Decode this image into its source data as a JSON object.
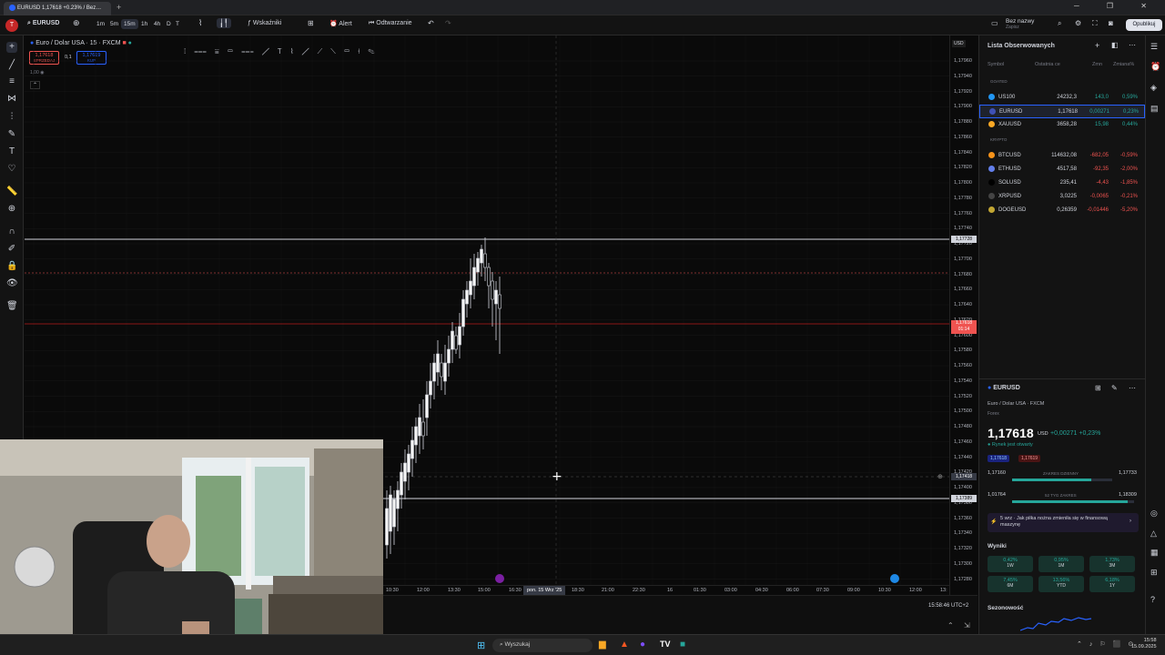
{
  "browser": {
    "tab_title": "EURUSD 1,17618 +0.23% / Bez…",
    "new_tab": "+"
  },
  "toolbar": {
    "symbol": "EURUSD",
    "timeframes": [
      "1m",
      "5m",
      "15m",
      "1h",
      "4h",
      "D",
      "T"
    ],
    "active_timeframe": "15m",
    "indicators_label": "Wskaźniki",
    "alert_label": "Alert",
    "replay_label": "Odtwarzanie",
    "layout_name": "Bez nazwy",
    "layout_sub": "Zapisz",
    "publish_label": "Opublikuj"
  },
  "chart_header": {
    "title": "Euro / Dolar USA · 15 · FXCM",
    "sell_price": "1,17618",
    "sell_label": "SPRZEDAJ",
    "spread": "0,1",
    "buy_price": "1,17619",
    "buy_label": "KUP",
    "volume": "1,00"
  },
  "price_axis": {
    "currency": "USD",
    "labels": [
      "1,17960",
      "1,17940",
      "1,17920",
      "1,17900",
      "1,17880",
      "1,17860",
      "1,17840",
      "1,17820",
      "1,17800",
      "1,17780",
      "1,17760",
      "1,17740",
      "1,17720",
      "1,17700",
      "1,17680",
      "1,17660",
      "1,17640",
      "1,17620",
      "1,17600",
      "1,17580",
      "1,17560",
      "1,17540",
      "1,17520",
      "1,17500",
      "1,17480",
      "1,17460",
      "1,17440",
      "1,17420",
      "1,17400",
      "1,17380",
      "1,17360",
      "1,17340",
      "1,17320",
      "1,17300",
      "1,17280"
    ],
    "upper_line_price": "1,17728",
    "current_price": "1,17618",
    "countdown": "01:14",
    "crosshair_price": "1,17418",
    "lower_line_price": "1,17389"
  },
  "time_axis": {
    "labels": [
      "10:30",
      "12:00",
      "13:30",
      "15:00",
      "16:30",
      "18:30",
      "21:00",
      "22:30",
      "16",
      "01:30",
      "03:00",
      "04:30",
      "06:00",
      "07:30",
      "09:00",
      "10:30",
      "12:00",
      "13:"
    ],
    "crosshair_label": "pon. 15 Wrz '25"
  },
  "bottom": {
    "clock": "15:58:46 UTC+2"
  },
  "watchlist": {
    "title": "Lista Obserwowanych",
    "columns": [
      "Symbol",
      "Ostatnia ce",
      "Zmn",
      "Zmiana%"
    ],
    "sections": [
      {
        "name": "GOATED",
        "rows": [
          {
            "symbol": "US100",
            "last": "24232,3",
            "chg": "143,0",
            "pct": "0,59%",
            "dir": "up",
            "icon_color": "#2196f3"
          },
          {
            "symbol": "EURUSD",
            "last": "1,17618",
            "chg": "0,00271",
            "pct": "0,23%",
            "dir": "up",
            "icon_color": "#3f51b5"
          },
          {
            "symbol": "XAUUSD",
            "last": "3658,28",
            "chg": "15,98",
            "pct": "0,44%",
            "dir": "up",
            "icon_color": "#f9a825"
          }
        ]
      },
      {
        "name": "KRYPTO",
        "rows": [
          {
            "symbol": "BTCUSD",
            "last": "114632,08",
            "chg": "-682,05",
            "pct": "-0,59%",
            "dir": "down",
            "icon_color": "#f7931a"
          },
          {
            "symbol": "ETHUSD",
            "last": "4517,58",
            "chg": "-92,35",
            "pct": "-2,00%",
            "dir": "down",
            "icon_color": "#627eea"
          },
          {
            "symbol": "SOLUSD",
            "last": "235,41",
            "chg": "-4,43",
            "pct": "-1,85%",
            "dir": "down",
            "icon_color": "#000000"
          },
          {
            "symbol": "XRPUSD",
            "last": "3,0225",
            "chg": "-0,0065",
            "pct": "-0,21%",
            "dir": "down",
            "icon_color": "#444444"
          },
          {
            "symbol": "DOGEUSD",
            "last": "0,26359",
            "chg": "-0,01446",
            "pct": "-5,20%",
            "dir": "down",
            "icon_color": "#c2a633"
          }
        ]
      }
    ]
  },
  "details": {
    "symbol": "EURUSD",
    "name": "Euro / Dolar USA",
    "exchange": "FXCM",
    "type": "Forex",
    "price": "1,17618",
    "currency": "USD",
    "change": "+0,00271",
    "change_pct": "+0,23%",
    "market_status": "Rynek jest otwarty",
    "bid": "1,17618",
    "ask": "1,17619",
    "day_low": "1,17160",
    "day_range_label": "ZAKRES DZIENNY",
    "day_high": "1,17733",
    "wk_low": "1,01764",
    "wk_range_label": "52 TYG ZAKRES",
    "wk_high": "1,18309",
    "day_range_fill": 0.79,
    "wk_range_fill": 0.95,
    "news": "5 wrz · Jak piłka nożna zmieniła się w finansową maszynę",
    "results_title": "Wyniki",
    "perf": [
      {
        "value": "0,42%",
        "label": "1W"
      },
      {
        "value": "0,95%",
        "label": "1M"
      },
      {
        "value": "1,73%",
        "label": "3M"
      },
      {
        "value": "7,45%",
        "label": "6M"
      },
      {
        "value": "13,56%",
        "label": "YTD"
      },
      {
        "value": "6,18%",
        "label": "1Y"
      }
    ],
    "seasonal_title": "Sezonowość"
  },
  "taskbar": {
    "search_placeholder": "Wyszukaj",
    "time": "15:58",
    "date": "15.09.2025"
  },
  "colors": {
    "up": "#26a69a",
    "down": "#ef5350",
    "accent": "#2962ff",
    "bg": "#0a0a0a"
  }
}
